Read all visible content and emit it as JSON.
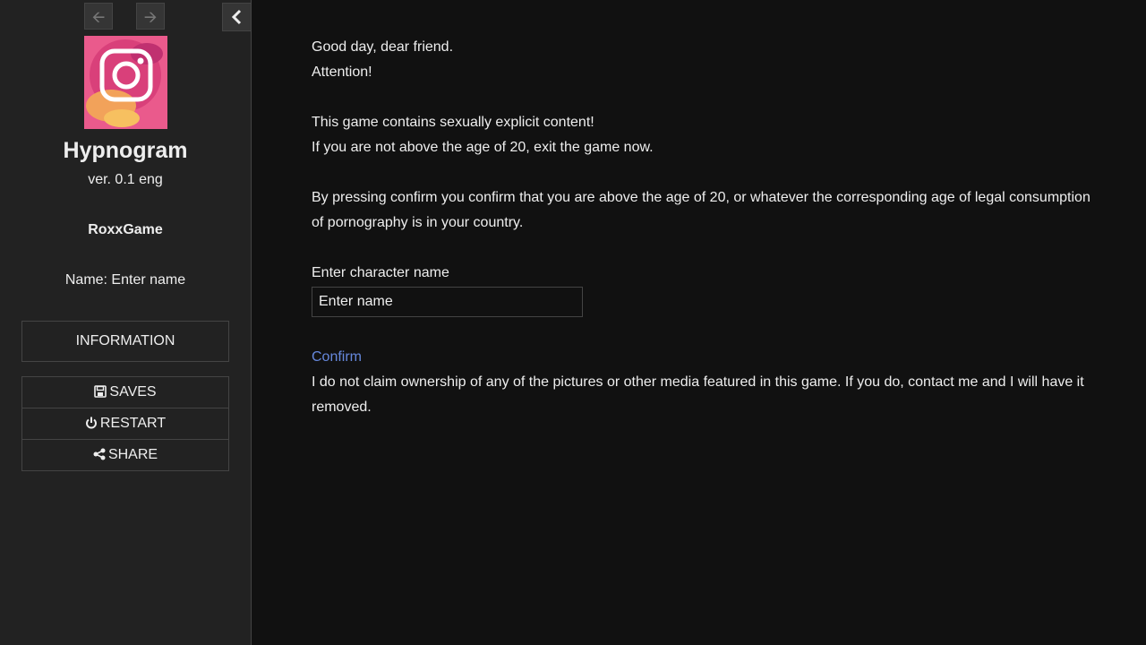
{
  "sidebar": {
    "back_icon": "arrow-left-icon",
    "forward_icon": "arrow-right-icon",
    "toggle_icon": "chevron-left-icon",
    "banner_icon": "instagram-logo",
    "title": "Hypnogram",
    "version": "ver. 0.1 eng",
    "author": "RoxxGame",
    "name_line": "Name: Enter name",
    "menu_info": "INFORMATION",
    "menu_saves": "SAVES",
    "menu_restart": "RESTART",
    "menu_share": "SHARE"
  },
  "passage": {
    "greeting": "Good day, dear friend.",
    "attention": "Attention!",
    "warning1": "This game contains sexually explicit content!",
    "warning2": "If you are not above the age of 20, exit the game now.",
    "consent": "By pressing confirm you confirm that you are above the age of 20, or whatever the corresponding age of legal consumption of pornography is in your country.",
    "name_label": "Enter character name",
    "name_value": "Enter name",
    "confirm": "Confirm",
    "disclaimer": "I do not claim ownership of any of the pictures or other media featured in this game. If you do, contact me and I will have it removed."
  },
  "colors": {
    "background": "#111111",
    "sidebar": "#222222",
    "text": "#eeeeee",
    "link": "#6688dd"
  }
}
